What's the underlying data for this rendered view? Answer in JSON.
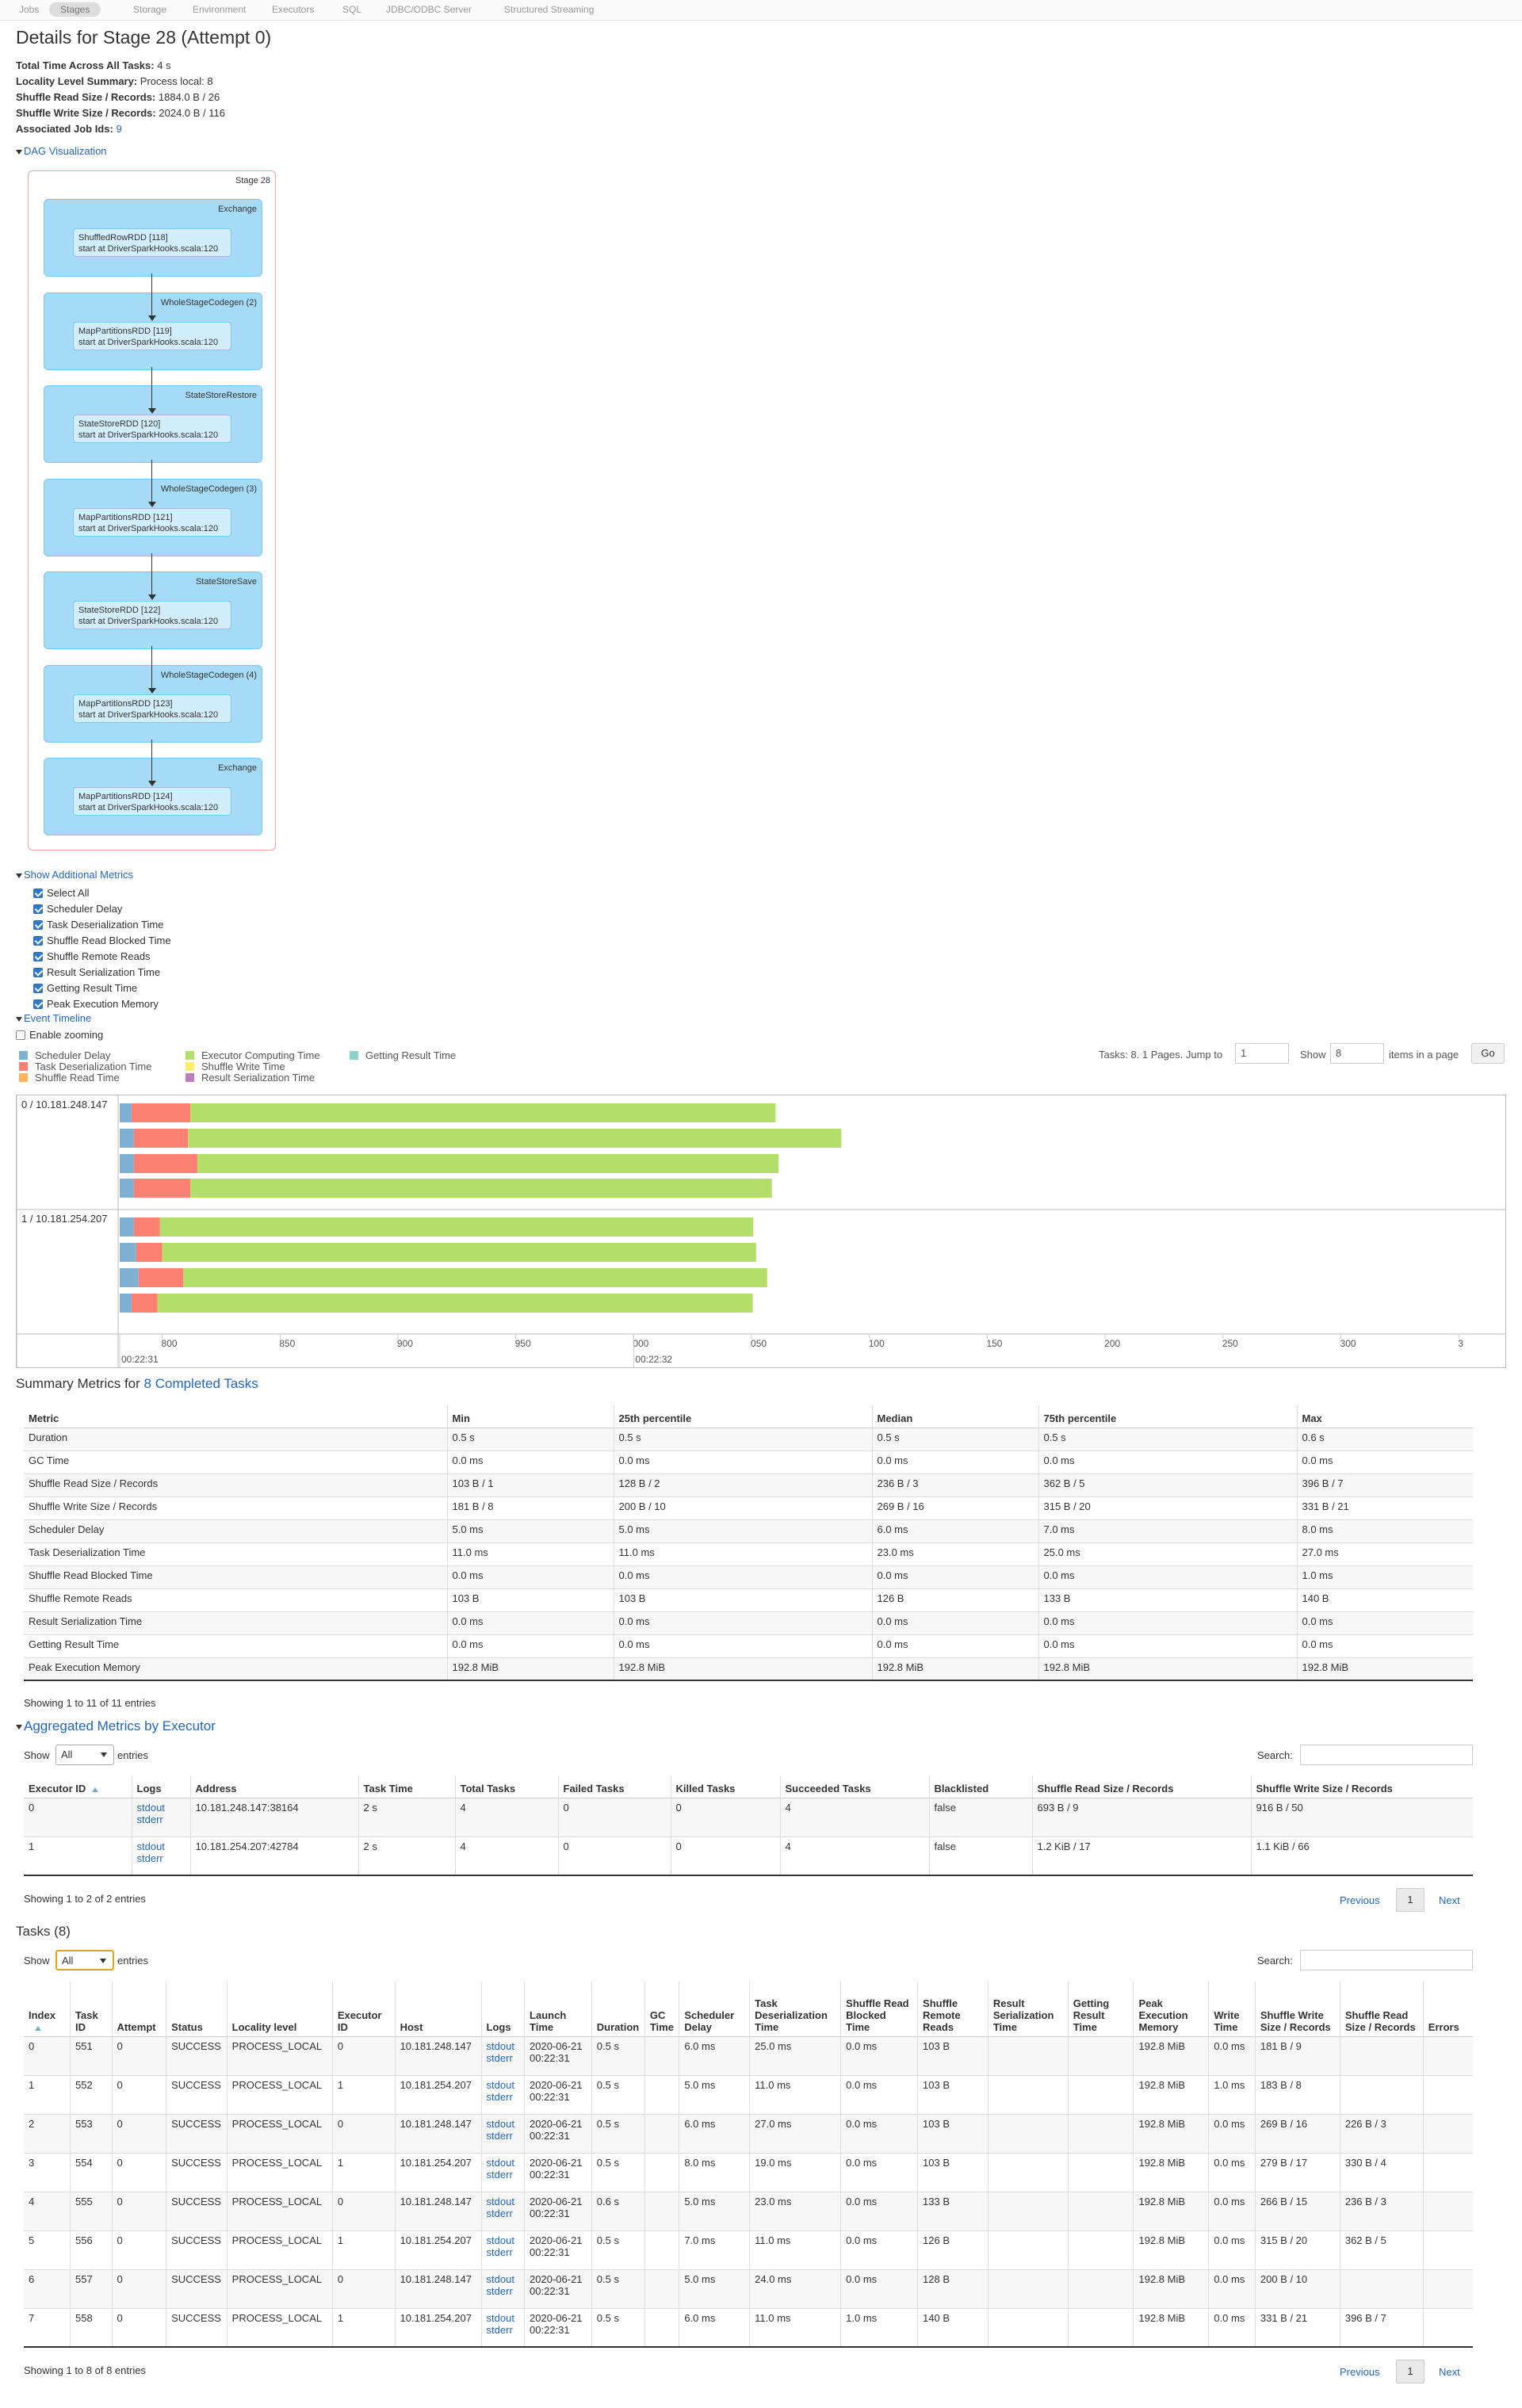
{
  "nav": {
    "tabs": [
      "Jobs",
      "Stages",
      "Storage",
      "Environment",
      "Executors",
      "SQL",
      "JDBC/ODBC Server",
      "Structured Streaming"
    ],
    "active": "Stages"
  },
  "page": {
    "title": "Details for Stage 28 (Attempt 0)",
    "summary": [
      {
        "label": "Total Time Across All Tasks:",
        "value": "4 s"
      },
      {
        "label": "Locality Level Summary:",
        "value": "Process local: 8"
      },
      {
        "label": "Shuffle Read Size / Records:",
        "value": "1884.0 B / 26"
      },
      {
        "label": "Shuffle Write Size / Records:",
        "value": "2024.0 B / 116"
      },
      {
        "label": "Associated Job Ids:",
        "value": "9"
      }
    ],
    "dag_toggle": "DAG Visualization"
  },
  "dag": {
    "stage_label": "Stage 28",
    "clusters": [
      {
        "name": "Exchange",
        "rdd": "ShuffledRowRDD [118]",
        "site": "start at DriverSparkHooks.scala:120"
      },
      {
        "name": "WholeStageCodegen (2)",
        "rdd": "MapPartitionsRDD [119]",
        "site": "start at DriverSparkHooks.scala:120"
      },
      {
        "name": "StateStoreRestore",
        "rdd": "StateStoreRDD [120]",
        "site": "start at DriverSparkHooks.scala:120"
      },
      {
        "name": "WholeStageCodegen (3)",
        "rdd": "MapPartitionsRDD [121]",
        "site": "start at DriverSparkHooks.scala:120"
      },
      {
        "name": "StateStoreSave",
        "rdd": "StateStoreRDD [122]",
        "site": "start at DriverSparkHooks.scala:120"
      },
      {
        "name": "WholeStageCodegen (4)",
        "rdd": "MapPartitionsRDD [123]",
        "site": "start at DriverSparkHooks.scala:120"
      },
      {
        "name": "Exchange",
        "rdd": "MapPartitionsRDD [124]",
        "site": "start at DriverSparkHooks.scala:120"
      }
    ]
  },
  "metrics": {
    "toggle": "Show Additional Metrics",
    "items": [
      "Select All",
      "Scheduler Delay",
      "Task Deserialization Time",
      "Shuffle Read Blocked Time",
      "Shuffle Remote Reads",
      "Result Serialization Time",
      "Getting Result Time",
      "Peak Execution Memory"
    ]
  },
  "timeline": {
    "toggle": "Event Timeline",
    "zoom_label": "Enable zooming",
    "legend": [
      {
        "label": "Scheduler Delay",
        "color": "#80b1d3"
      },
      {
        "label": "Task Deserialization Time",
        "color": "#fb8072"
      },
      {
        "label": "Shuffle Read Time",
        "color": "#fdb462"
      },
      {
        "label": "Executor Computing Time",
        "color": "#b3de69"
      },
      {
        "label": "Shuffle Write Time",
        "color": "#ffed6f"
      },
      {
        "label": "Result Serialization Time",
        "color": "#bc80bd"
      },
      {
        "label": "Getting Result Time",
        "color": "#8dd3c7"
      }
    ],
    "controls": {
      "tasks_text": "Tasks: 8. 1 Pages. Jump to",
      "jump_value": "1",
      "show_label": "Show",
      "show_value": "8",
      "items_label": "items in a page",
      "go": "Go"
    },
    "groups": [
      "0 / 10.181.248.147",
      "1 / 10.181.254.207"
    ],
    "axis_ticks": [
      "800",
      "850",
      "900",
      "950",
      "000",
      "050",
      "100",
      "150",
      "200",
      "250",
      "300",
      "3"
    ],
    "axis_sub": [
      "00:22:31",
      "00:22:32"
    ],
    "tasks": [
      {
        "group": 0,
        "start": 782,
        "sched": 5,
        "deser": 25,
        "compute": 1264
      },
      {
        "group": 0,
        "start": 782,
        "sched": 6,
        "deser": 23,
        "compute": 1411
      },
      {
        "group": 0,
        "start": 782,
        "sched": 6,
        "deser": 27,
        "compute": 1255
      },
      {
        "group": 0,
        "start": 782,
        "sched": 6,
        "deser": 24,
        "compute": 1256
      },
      {
        "group": 1,
        "start": 782,
        "sched": 6,
        "deser": 11,
        "compute": 1282
      },
      {
        "group": 1,
        "start": 782,
        "sched": 7,
        "deser": 11,
        "compute": 1283
      },
      {
        "group": 1,
        "start": 782,
        "sched": 8,
        "deser": 19,
        "compute": 1261
      },
      {
        "group": 1,
        "start": 782,
        "sched": 5,
        "deser": 11,
        "compute": 1286
      }
    ]
  },
  "summary_metrics": {
    "title_prefix": "Summary Metrics for",
    "title_link": "8 Completed Tasks",
    "headers": [
      "Metric",
      "Min",
      "25th percentile",
      "Median",
      "75th percentile",
      "Max"
    ],
    "rows": [
      [
        "Duration",
        "0.5 s",
        "0.5 s",
        "0.5 s",
        "0.5 s",
        "0.6 s"
      ],
      [
        "GC Time",
        "0.0 ms",
        "0.0 ms",
        "0.0 ms",
        "0.0 ms",
        "0.0 ms"
      ],
      [
        "Shuffle Read Size / Records",
        "103 B / 1",
        "128 B / 2",
        "236 B / 3",
        "362 B / 5",
        "396 B / 7"
      ],
      [
        "Shuffle Write Size / Records",
        "181 B / 8",
        "200 B / 10",
        "269 B / 16",
        "315 B / 20",
        "331 B / 21"
      ],
      [
        "Scheduler Delay",
        "5.0 ms",
        "5.0 ms",
        "6.0 ms",
        "7.0 ms",
        "8.0 ms"
      ],
      [
        "Task Deserialization Time",
        "11.0 ms",
        "11.0 ms",
        "23.0 ms",
        "25.0 ms",
        "27.0 ms"
      ],
      [
        "Shuffle Read Blocked Time",
        "0.0 ms",
        "0.0 ms",
        "0.0 ms",
        "0.0 ms",
        "1.0 ms"
      ],
      [
        "Shuffle Remote Reads",
        "103 B",
        "103 B",
        "126 B",
        "133 B",
        "140 B"
      ],
      [
        "Result Serialization Time",
        "0.0 ms",
        "0.0 ms",
        "0.0 ms",
        "0.0 ms",
        "0.0 ms"
      ],
      [
        "Getting Result Time",
        "0.0 ms",
        "0.0 ms",
        "0.0 ms",
        "0.0 ms",
        "0.0 ms"
      ],
      [
        "Peak Execution Memory",
        "192.8 MiB",
        "192.8 MiB",
        "192.8 MiB",
        "192.8 MiB",
        "192.8 MiB"
      ]
    ],
    "footer": "Showing 1 to 11 of 11 entries"
  },
  "executors": {
    "toggle": "Aggregated Metrics by Executor",
    "show_label": "Show",
    "select_value": "All",
    "entries_label": "entries",
    "search_label": "Search:",
    "headers": [
      "Executor ID",
      "Logs",
      "Address",
      "Task Time",
      "Total Tasks",
      "Failed Tasks",
      "Killed Tasks",
      "Succeeded Tasks",
      "Blacklisted",
      "Shuffle Read Size / Records",
      "Shuffle Write Size / Records"
    ],
    "rows": [
      [
        "0",
        "stdout|stderr",
        "10.181.248.147:38164",
        "2 s",
        "4",
        "0",
        "0",
        "4",
        "false",
        "693 B / 9",
        "916 B / 50"
      ],
      [
        "1",
        "stdout|stderr",
        "10.181.254.207:42784",
        "2 s",
        "4",
        "0",
        "0",
        "4",
        "false",
        "1.2 KiB / 17",
        "1.1 KiB / 66"
      ]
    ],
    "footer": "Showing 1 to 2 of 2 entries",
    "prev": "Previous",
    "page": "1",
    "next": "Next"
  },
  "tasks": {
    "title": "Tasks (8)",
    "show_label": "Show",
    "select_value": "All",
    "entries_label": "entries",
    "search_label": "Search:",
    "headers": [
      "Index",
      "Task ID",
      "Attempt",
      "Status",
      "Locality level",
      "Executor ID",
      "Host",
      "Logs",
      "Launch Time",
      "Duration",
      "GC Time",
      "Scheduler Delay",
      "Task Deserialization Time",
      "Shuffle Read Blocked Time",
      "Shuffle Remote Reads",
      "Result Serialization Time",
      "Getting Result Time",
      "Peak Execution Memory",
      "Write Time",
      "Shuffle Write Size / Records",
      "Shuffle Read Size / Records",
      "Errors"
    ],
    "rows": [
      [
        "0",
        "551",
        "0",
        "SUCCESS",
        "PROCESS_LOCAL",
        "0",
        "10.181.248.147",
        "stdout|stderr",
        "2020-06-21 00:22:31",
        "0.5 s",
        "",
        "6.0 ms",
        "25.0 ms",
        "0.0 ms",
        "103 B",
        "",
        "",
        "192.8 MiB",
        "0.0 ms",
        "181 B / 9",
        "",
        ""
      ],
      [
        "1",
        "552",
        "0",
        "SUCCESS",
        "PROCESS_LOCAL",
        "1",
        "10.181.254.207",
        "stdout|stderr",
        "2020-06-21 00:22:31",
        "0.5 s",
        "",
        "5.0 ms",
        "11.0 ms",
        "0.0 ms",
        "103 B",
        "",
        "",
        "192.8 MiB",
        "1.0 ms",
        "183 B / 8",
        "",
        ""
      ],
      [
        "2",
        "553",
        "0",
        "SUCCESS",
        "PROCESS_LOCAL",
        "0",
        "10.181.248.147",
        "stdout|stderr",
        "2020-06-21 00:22:31",
        "0.5 s",
        "",
        "6.0 ms",
        "27.0 ms",
        "0.0 ms",
        "103 B",
        "",
        "",
        "192.8 MiB",
        "0.0 ms",
        "269 B / 16",
        "226 B / 3",
        ""
      ],
      [
        "3",
        "554",
        "0",
        "SUCCESS",
        "PROCESS_LOCAL",
        "1",
        "10.181.254.207",
        "stdout|stderr",
        "2020-06-21 00:22:31",
        "0.5 s",
        "",
        "8.0 ms",
        "19.0 ms",
        "0.0 ms",
        "103 B",
        "",
        "",
        "192.8 MiB",
        "0.0 ms",
        "279 B / 17",
        "330 B / 4",
        ""
      ],
      [
        "4",
        "555",
        "0",
        "SUCCESS",
        "PROCESS_LOCAL",
        "0",
        "10.181.248.147",
        "stdout|stderr",
        "2020-06-21 00:22:31",
        "0.6 s",
        "",
        "5.0 ms",
        "23.0 ms",
        "0.0 ms",
        "133 B",
        "",
        "",
        "192.8 MiB",
        "0.0 ms",
        "266 B / 15",
        "236 B / 3",
        ""
      ],
      [
        "5",
        "556",
        "0",
        "SUCCESS",
        "PROCESS_LOCAL",
        "1",
        "10.181.254.207",
        "stdout|stderr",
        "2020-06-21 00:22:31",
        "0.5 s",
        "",
        "7.0 ms",
        "11.0 ms",
        "0.0 ms",
        "126 B",
        "",
        "",
        "192.8 MiB",
        "0.0 ms",
        "315 B / 20",
        "362 B / 5",
        ""
      ],
      [
        "6",
        "557",
        "0",
        "SUCCESS",
        "PROCESS_LOCAL",
        "0",
        "10.181.248.147",
        "stdout|stderr",
        "2020-06-21 00:22:31",
        "0.5 s",
        "",
        "5.0 ms",
        "24.0 ms",
        "0.0 ms",
        "128 B",
        "",
        "",
        "192.8 MiB",
        "0.0 ms",
        "200 B / 10",
        "",
        ""
      ],
      [
        "7",
        "558",
        "0",
        "SUCCESS",
        "PROCESS_LOCAL",
        "1",
        "10.181.254.207",
        "stdout|stderr",
        "2020-06-21 00:22:31",
        "0.5 s",
        "",
        "6.0 ms",
        "11.0 ms",
        "1.0 ms",
        "140 B",
        "",
        "",
        "192.8 MiB",
        "0.0 ms",
        "331 B / 21",
        "396 B / 7",
        ""
      ]
    ],
    "footer": "Showing 1 to 8 of 8 entries",
    "prev": "Previous",
    "page": "1",
    "next": "Next"
  }
}
